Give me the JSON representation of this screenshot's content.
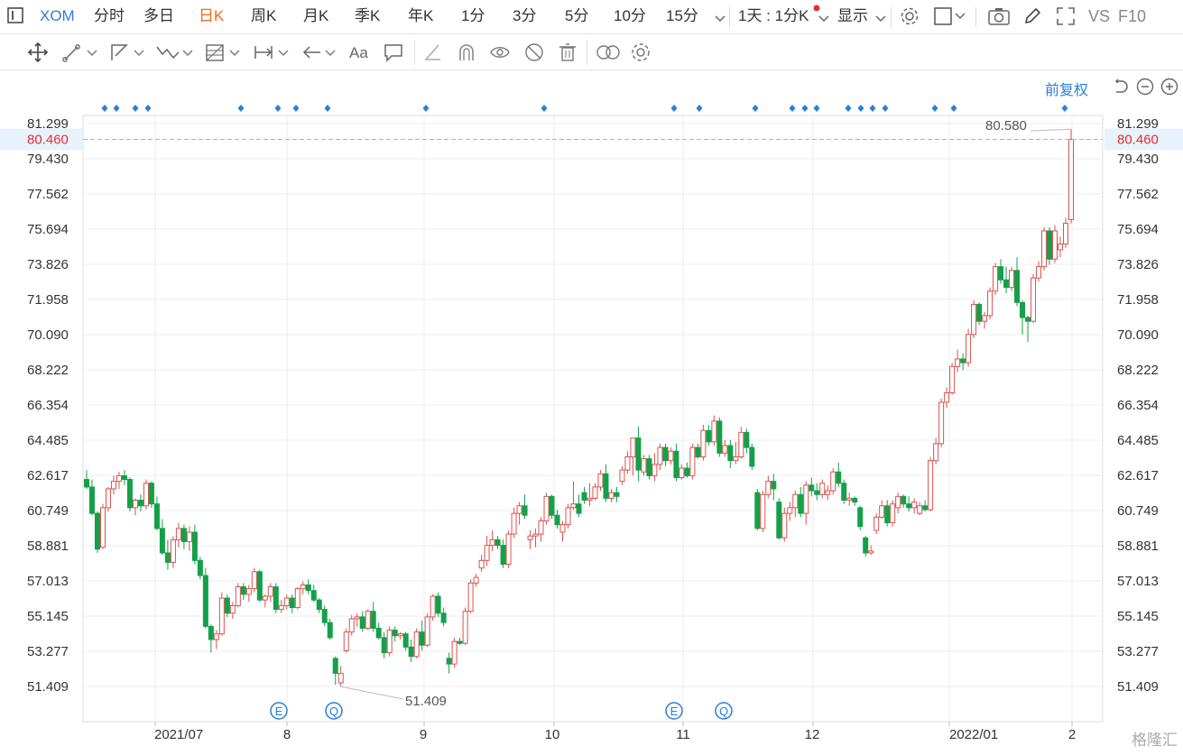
{
  "header": {
    "symbol": "XOM",
    "periods": [
      "分时",
      "多日",
      "日K",
      "周K",
      "月K",
      "季K",
      "年K",
      "1分",
      "3分",
      "5分",
      "10分",
      "15分"
    ],
    "active_period": "日K",
    "interval": "1天 : 1分K",
    "display": "显示",
    "compare": "VS",
    "f10": "F10"
  },
  "icons": {
    "top": [
      "sidebar-toggle-icon",
      "settings-icon",
      "box-icon",
      "camera-icon",
      "pencil-icon",
      "fullscreen-icon"
    ],
    "tools": [
      "move-icon",
      "line-tool-icon",
      "path-tool-icon",
      "wave-tool-icon",
      "fib-tool-icon",
      "range-tool-icon",
      "arrow-tool-icon",
      "text-tool-icon",
      "comment-tool-icon",
      "angle-tool-icon",
      "magnet-icon",
      "eye-tool-icon",
      "hide-icon",
      "trash-icon",
      "link-icon",
      "gear-icon"
    ],
    "chart_controls": [
      "reset-icon",
      "zoom-out-icon",
      "zoom-in-icon"
    ]
  },
  "price_adjust": "前复权",
  "current_price": "80.460",
  "high_label": "80.580",
  "low_label": "51.409",
  "colors": {
    "up": "#d9534f",
    "down": "#14a04a",
    "accent": "#2a7fd6",
    "active": "#f26a1b",
    "dash": "#f0a060",
    "event": "#2a7fd6"
  },
  "event_markers": [
    "E",
    "Q",
    "E",
    "Q"
  ],
  "watermark": "格隆汇",
  "chart_data": {
    "type": "candlestick",
    "yticks": [
      "81.299",
      "79.430",
      "77.562",
      "75.694",
      "73.826",
      "71.958",
      "70.090",
      "68.222",
      "66.354",
      "64.485",
      "62.617",
      "60.749",
      "58.881",
      "57.013",
      "55.145",
      "53.277",
      "51.409"
    ],
    "ylim": [
      51.409,
      81.299
    ],
    "xticks": [
      "2021/07",
      "8",
      "9",
      "10",
      "11",
      "12",
      "2022/01",
      "2"
    ],
    "grid": true,
    "candles": [
      [
        62.4,
        62.9,
        61.9,
        62.0
      ],
      [
        62.0,
        62.4,
        60.5,
        60.6
      ],
      [
        60.6,
        60.7,
        58.5,
        58.7
      ],
      [
        58.8,
        61.1,
        58.7,
        60.9
      ],
      [
        60.9,
        62.0,
        60.7,
        61.9
      ],
      [
        61.9,
        62.6,
        61.6,
        62.3
      ],
      [
        62.3,
        62.8,
        61.9,
        62.6
      ],
      [
        62.6,
        62.9,
        62.1,
        62.4
      ],
      [
        62.4,
        62.5,
        60.7,
        60.9
      ],
      [
        60.9,
        61.4,
        60.5,
        61.3
      ],
      [
        61.3,
        61.6,
        60.7,
        61.0
      ],
      [
        61.0,
        62.4,
        60.8,
        62.2
      ],
      [
        62.2,
        62.3,
        60.9,
        61.1
      ],
      [
        61.1,
        61.5,
        59.7,
        59.8
      ],
      [
        59.8,
        60.3,
        58.4,
        58.5
      ],
      [
        58.5,
        59.2,
        57.6,
        58.0
      ],
      [
        58.0,
        59.4,
        57.7,
        59.2
      ],
      [
        59.2,
        60.1,
        58.8,
        59.8
      ],
      [
        59.8,
        60.0,
        58.7,
        59.1
      ],
      [
        59.1,
        59.9,
        58.6,
        59.6
      ],
      [
        59.6,
        60.0,
        57.9,
        58.1
      ],
      [
        58.1,
        58.3,
        57.1,
        57.3
      ],
      [
        57.3,
        57.7,
        54.5,
        54.6
      ],
      [
        54.6,
        54.7,
        53.2,
        53.9
      ],
      [
        53.9,
        54.4,
        53.4,
        54.2
      ],
      [
        54.2,
        56.4,
        54.1,
        56.1
      ],
      [
        56.1,
        56.3,
        55.1,
        55.3
      ],
      [
        55.3,
        55.9,
        55.0,
        55.7
      ],
      [
        55.7,
        56.9,
        55.6,
        56.7
      ],
      [
        56.7,
        56.9,
        56.0,
        56.3
      ],
      [
        56.3,
        56.8,
        55.9,
        56.6
      ],
      [
        56.6,
        57.7,
        56.4,
        57.5
      ],
      [
        57.5,
        57.6,
        55.9,
        56.0
      ],
      [
        56.0,
        56.3,
        55.6,
        56.2
      ],
      [
        56.2,
        56.9,
        55.9,
        56.7
      ],
      [
        56.7,
        56.9,
        55.3,
        55.5
      ],
      [
        55.5,
        56.0,
        55.3,
        55.7
      ],
      [
        55.7,
        56.3,
        55.5,
        56.1
      ],
      [
        56.1,
        56.3,
        55.3,
        55.6
      ],
      [
        55.6,
        56.7,
        55.5,
        56.6
      ],
      [
        56.6,
        57.0,
        56.3,
        56.8
      ],
      [
        56.8,
        57.1,
        56.3,
        56.5
      ],
      [
        56.5,
        56.8,
        55.9,
        56.0
      ],
      [
        56.0,
        56.1,
        55.3,
        55.5
      ],
      [
        55.5,
        55.7,
        54.6,
        54.8
      ],
      [
        54.8,
        55.0,
        53.9,
        54.0
      ],
      [
        52.9,
        53.0,
        51.5,
        52.1
      ],
      [
        51.6,
        52.5,
        51.4,
        52.1
      ],
      [
        53.3,
        54.5,
        53.2,
        54.3
      ],
      [
        54.3,
        55.2,
        54.1,
        55.0
      ],
      [
        55.0,
        55.3,
        54.6,
        55.1
      ],
      [
        55.1,
        55.4,
        54.3,
        54.5
      ],
      [
        54.5,
        55.5,
        54.4,
        55.4
      ],
      [
        55.4,
        55.9,
        54.3,
        54.5
      ],
      [
        54.5,
        54.8,
        53.9,
        54.0
      ],
      [
        54.0,
        54.3,
        52.9,
        53.2
      ],
      [
        53.2,
        54.6,
        53.0,
        54.4
      ],
      [
        54.4,
        54.6,
        53.8,
        54.1
      ],
      [
        54.1,
        54.3,
        53.9,
        54.2
      ],
      [
        54.2,
        54.3,
        53.3,
        53.5
      ],
      [
        53.5,
        53.9,
        52.7,
        53.0
      ],
      [
        53.0,
        54.5,
        52.9,
        54.3
      ],
      [
        54.3,
        54.9,
        53.3,
        53.6
      ],
      [
        53.6,
        55.3,
        53.5,
        55.1
      ],
      [
        55.1,
        56.3,
        54.9,
        56.2
      ],
      [
        56.2,
        56.4,
        55.1,
        55.3
      ],
      [
        55.3,
        55.6,
        54.6,
        54.8
      ],
      [
        52.9,
        53.2,
        52.1,
        52.6
      ],
      [
        52.6,
        54.0,
        52.4,
        53.8
      ],
      [
        53.8,
        54.0,
        53.6,
        53.7
      ],
      [
        53.7,
        55.6,
        53.6,
        55.4
      ],
      [
        55.4,
        57.1,
        55.3,
        56.9
      ],
      [
        56.9,
        57.4,
        56.7,
        57.2
      ],
      [
        57.7,
        58.4,
        57.5,
        58.1
      ],
      [
        58.1,
        59.4,
        57.8,
        58.9
      ],
      [
        58.9,
        59.7,
        58.6,
        59.2
      ],
      [
        59.2,
        59.4,
        58.7,
        58.9
      ],
      [
        58.9,
        59.2,
        57.7,
        57.9
      ],
      [
        57.9,
        59.7,
        57.7,
        59.5
      ],
      [
        59.5,
        60.9,
        59.3,
        60.6
      ],
      [
        60.6,
        61.2,
        60.0,
        61.0
      ],
      [
        61.0,
        61.6,
        60.3,
        60.5
      ],
      [
        59.2,
        59.7,
        58.7,
        59.4
      ],
      [
        59.4,
        59.8,
        58.8,
        59.5
      ],
      [
        59.5,
        60.4,
        59.1,
        60.2
      ],
      [
        60.2,
        61.7,
        60.0,
        61.5
      ],
      [
        61.5,
        61.6,
        60.3,
        60.5
      ],
      [
        60.5,
        60.8,
        59.8,
        60.0
      ],
      [
        59.6,
        60.2,
        59.1,
        60.0
      ],
      [
        60.0,
        61.1,
        59.8,
        60.9
      ],
      [
        60.9,
        62.3,
        60.8,
        61.1
      ],
      [
        61.1,
        61.6,
        60.4,
        60.6
      ],
      [
        61.7,
        62.0,
        61.1,
        61.3
      ],
      [
        61.3,
        62.2,
        61.0,
        61.4
      ],
      [
        61.4,
        62.2,
        61.3,
        62.0
      ],
      [
        62.0,
        62.9,
        61.8,
        62.7
      ],
      [
        62.7,
        63.2,
        61.2,
        61.4
      ],
      [
        61.4,
        61.9,
        61.2,
        61.7
      ],
      [
        61.7,
        62.0,
        61.2,
        61.5
      ],
      [
        62.3,
        63.1,
        62.1,
        62.9
      ],
      [
        62.9,
        63.9,
        62.7,
        63.6
      ],
      [
        63.6,
        64.5,
        62.6,
        64.6
      ],
      [
        64.6,
        65.2,
        62.3,
        62.9
      ],
      [
        62.8,
        63.7,
        62.6,
        63.5
      ],
      [
        63.5,
        63.7,
        62.4,
        62.6
      ],
      [
        62.6,
        63.8,
        62.3,
        63.2
      ],
      [
        63.2,
        64.3,
        62.9,
        64.1
      ],
      [
        64.1,
        64.3,
        63.1,
        63.4
      ],
      [
        63.4,
        64.1,
        63.2,
        63.9
      ],
      [
        63.9,
        64.3,
        62.3,
        62.5
      ],
      [
        62.5,
        63.2,
        62.4,
        63.0
      ],
      [
        63.0,
        63.3,
        62.5,
        62.6
      ],
      [
        62.6,
        64.3,
        62.4,
        64.1
      ],
      [
        64.1,
        64.3,
        63.5,
        63.6
      ],
      [
        63.6,
        65.3,
        63.4,
        65.0
      ],
      [
        65.0,
        65.3,
        64.2,
        64.4
      ],
      [
        64.4,
        65.8,
        64.2,
        65.5
      ],
      [
        65.5,
        65.7,
        63.6,
        63.8
      ],
      [
        63.8,
        64.5,
        63.6,
        64.2
      ],
      [
        64.2,
        64.5,
        63.0,
        63.4
      ],
      [
        63.4,
        64.4,
        63.2,
        63.6
      ],
      [
        63.6,
        65.2,
        63.5,
        64.9
      ],
      [
        64.9,
        65.1,
        63.8,
        64.1
      ],
      [
        64.1,
        64.3,
        62.9,
        63.1
      ],
      [
        61.7,
        61.9,
        59.7,
        59.8
      ],
      [
        59.8,
        61.8,
        59.6,
        61.6
      ],
      [
        61.6,
        62.6,
        61.4,
        62.3
      ],
      [
        62.3,
        62.7,
        61.3,
        61.9
      ],
      [
        61.2,
        61.4,
        59.2,
        59.3
      ],
      [
        59.3,
        60.9,
        59.1,
        60.6
      ],
      [
        60.6,
        61.2,
        60.2,
        60.9
      ],
      [
        60.9,
        61.8,
        60.4,
        61.6
      ],
      [
        61.6,
        62.0,
        60.4,
        60.6
      ],
      [
        60.6,
        62.3,
        60.0,
        62.1
      ],
      [
        62.1,
        62.5,
        61.5,
        61.8
      ],
      [
        61.8,
        62.2,
        61.3,
        61.6
      ],
      [
        61.6,
        62.4,
        61.4,
        62.2
      ],
      [
        61.6,
        62.1,
        61.3,
        61.8
      ],
      [
        61.8,
        63.0,
        61.6,
        62.8
      ],
      [
        62.8,
        63.3,
        62.0,
        62.2
      ],
      [
        62.2,
        62.4,
        61.1,
        61.3
      ],
      [
        61.3,
        61.7,
        61.0,
        61.4
      ],
      [
        61.4,
        61.5,
        61.0,
        61.2
      ],
      [
        60.9,
        61.0,
        59.7,
        59.9
      ],
      [
        59.3,
        59.4,
        58.3,
        58.5
      ],
      [
        58.5,
        58.9,
        58.4,
        58.6
      ],
      [
        59.7,
        60.6,
        59.5,
        60.4
      ],
      [
        60.4,
        61.3,
        60.3,
        61.0
      ],
      [
        61.0,
        61.3,
        59.9,
        60.1
      ],
      [
        60.1,
        61.3,
        59.9,
        61.1
      ],
      [
        60.9,
        61.7,
        60.6,
        61.5
      ],
      [
        61.5,
        61.6,
        60.9,
        61.1
      ],
      [
        61.1,
        61.5,
        60.7,
        60.9
      ],
      [
        60.9,
        61.4,
        60.6,
        61.2
      ],
      [
        60.6,
        61.2,
        60.5,
        61.0
      ],
      [
        61.0,
        61.3,
        60.7,
        60.8
      ],
      [
        60.8,
        63.6,
        60.7,
        63.4
      ],
      [
        63.4,
        64.6,
        63.2,
        64.3
      ],
      [
        64.3,
        66.7,
        64.1,
        66.5
      ],
      [
        66.5,
        67.3,
        66.2,
        67.0
      ],
      [
        67.0,
        68.6,
        66.9,
        68.4
      ],
      [
        68.4,
        69.3,
        68.1,
        68.8
      ],
      [
        68.8,
        69.1,
        68.2,
        68.6
      ],
      [
        68.6,
        70.4,
        68.4,
        70.1
      ],
      [
        70.1,
        71.9,
        69.9,
        71.7
      ],
      [
        71.7,
        71.8,
        70.6,
        70.8
      ],
      [
        70.8,
        71.3,
        70.4,
        71.1
      ],
      [
        71.1,
        72.6,
        70.9,
        72.4
      ],
      [
        72.4,
        73.9,
        72.2,
        73.7
      ],
      [
        73.7,
        74.1,
        72.8,
        73.0
      ],
      [
        73.0,
        73.7,
        72.3,
        72.6
      ],
      [
        72.6,
        73.7,
        72.4,
        73.5
      ],
      [
        73.5,
        74.2,
        71.6,
        71.8
      ],
      [
        71.8,
        71.9,
        70.1,
        71.0
      ],
      [
        71.0,
        71.1,
        69.7,
        70.8
      ],
      [
        70.8,
        73.3,
        70.7,
        73.1
      ],
      [
        73.1,
        74.0,
        72.9,
        73.7
      ],
      [
        73.7,
        75.8,
        73.5,
        75.6
      ],
      [
        75.6,
        75.8,
        73.8,
        74.1
      ],
      [
        74.1,
        75.9,
        73.9,
        75.6
      ],
      [
        74.6,
        75.3,
        74.2,
        74.9
      ],
      [
        74.9,
        76.3,
        74.7,
        76.0
      ],
      [
        76.2,
        81.0,
        76.0,
        80.46
      ]
    ]
  }
}
